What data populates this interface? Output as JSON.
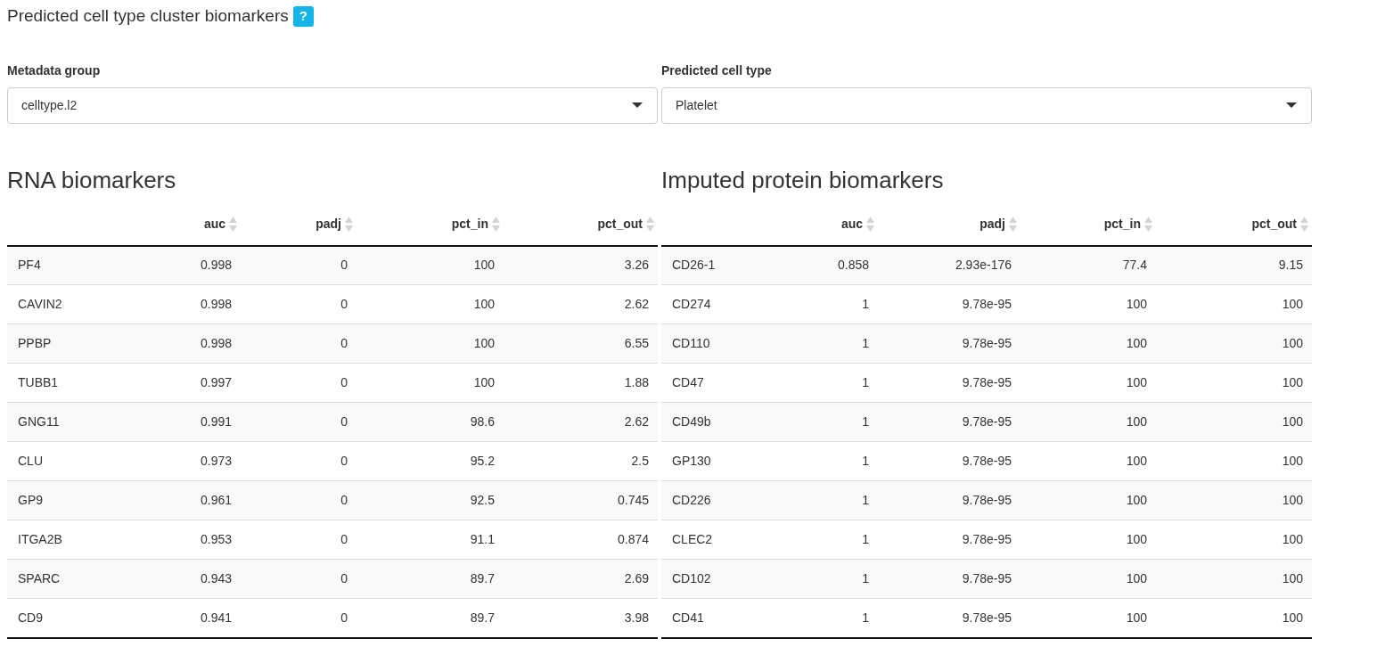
{
  "title": "Predicted cell type cluster biomarkers",
  "help_badge": "?",
  "filters": [
    {
      "label": "Metadata group",
      "value": "celltype.l2"
    },
    {
      "label": "Predicted cell type",
      "value": "Platelet"
    }
  ],
  "tables": [
    {
      "heading": "RNA biomarkers",
      "columns": [
        "",
        "auc",
        "padj",
        "pct_in",
        "pct_out"
      ],
      "rows": [
        [
          "PF4",
          "0.998",
          "0",
          "100",
          "3.26"
        ],
        [
          "CAVIN2",
          "0.998",
          "0",
          "100",
          "2.62"
        ],
        [
          "PPBP",
          "0.998",
          "0",
          "100",
          "6.55"
        ],
        [
          "TUBB1",
          "0.997",
          "0",
          "100",
          "1.88"
        ],
        [
          "GNG11",
          "0.991",
          "0",
          "98.6",
          "2.62"
        ],
        [
          "CLU",
          "0.973",
          "0",
          "95.2",
          "2.5"
        ],
        [
          "GP9",
          "0.961",
          "0",
          "92.5",
          "0.745"
        ],
        [
          "ITGA2B",
          "0.953",
          "0",
          "91.1",
          "0.874"
        ],
        [
          "SPARC",
          "0.943",
          "0",
          "89.7",
          "2.69"
        ],
        [
          "CD9",
          "0.941",
          "0",
          "89.7",
          "3.98"
        ]
      ]
    },
    {
      "heading": "Imputed protein biomarkers",
      "columns": [
        "",
        "auc",
        "padj",
        "pct_in",
        "pct_out"
      ],
      "rows": [
        [
          "CD26-1",
          "0.858",
          "2.93e-176",
          "77.4",
          "9.15"
        ],
        [
          "CD274",
          "1",
          "9.78e-95",
          "100",
          "100"
        ],
        [
          "CD110",
          "1",
          "9.78e-95",
          "100",
          "100"
        ],
        [
          "CD47",
          "1",
          "9.78e-95",
          "100",
          "100"
        ],
        [
          "CD49b",
          "1",
          "9.78e-95",
          "100",
          "100"
        ],
        [
          "GP130",
          "1",
          "9.78e-95",
          "100",
          "100"
        ],
        [
          "CD226",
          "1",
          "9.78e-95",
          "100",
          "100"
        ],
        [
          "CLEC2",
          "1",
          "9.78e-95",
          "100",
          "100"
        ],
        [
          "CD102",
          "1",
          "9.78e-95",
          "100",
          "100"
        ],
        [
          "CD41",
          "1",
          "9.78e-95",
          "100",
          "100"
        ]
      ]
    }
  ]
}
